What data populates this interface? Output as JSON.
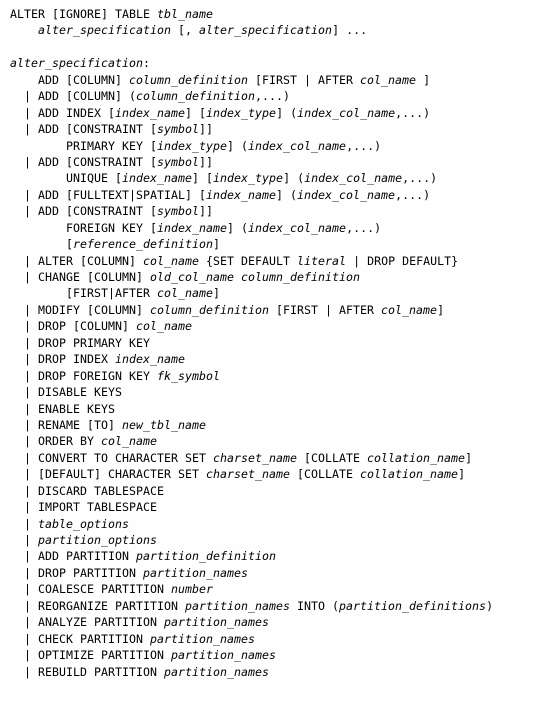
{
  "document": {
    "kind": "sql-syntax-reference",
    "statement": "ALTER TABLE",
    "background_color": "#fefefe",
    "text_color": "#000000",
    "font_size_px": 11.6,
    "line_height_px": 16.45,
    "right_edge_clipped": true
  },
  "lines": [
    {
      "indent": 0,
      "spans": [
        {
          "t": "ALTER [IGNORE] TABLE ",
          "s": "kw"
        },
        {
          "t": "tbl_name",
          "s": "ph"
        }
      ]
    },
    {
      "indent": 0,
      "spans": [
        {
          "t": "    ",
          "s": "kw"
        },
        {
          "t": "alter_specification",
          "s": "ph"
        },
        {
          "t": " [, ",
          "s": "kw"
        },
        {
          "t": "alter_specification",
          "s": "ph"
        },
        {
          "t": "] ...",
          "s": "kw"
        }
      ]
    },
    {
      "indent": 0,
      "spans": []
    },
    {
      "indent": 0,
      "spans": [
        {
          "t": "alter_specification",
          "s": "ph"
        },
        {
          "t": ":",
          "s": "kw"
        }
      ]
    },
    {
      "indent": 0,
      "spans": [
        {
          "t": "    ADD [COLUMN] ",
          "s": "kw"
        },
        {
          "t": "column_definition",
          "s": "ph"
        },
        {
          "t": " [FIRST | AFTER ",
          "s": "kw"
        },
        {
          "t": "col_name",
          "s": "ph"
        },
        {
          "t": " ]",
          "s": "kw"
        }
      ]
    },
    {
      "indent": 0,
      "spans": [
        {
          "t": "  | ADD [COLUMN] (",
          "s": "kw"
        },
        {
          "t": "column_definition",
          "s": "ph"
        },
        {
          "t": ",...)",
          "s": "kw"
        }
      ]
    },
    {
      "indent": 0,
      "spans": [
        {
          "t": "  | ADD INDEX [",
          "s": "kw"
        },
        {
          "t": "index_name",
          "s": "ph"
        },
        {
          "t": "] [",
          "s": "kw"
        },
        {
          "t": "index_type",
          "s": "ph"
        },
        {
          "t": "] (",
          "s": "kw"
        },
        {
          "t": "index_col_name",
          "s": "ph"
        },
        {
          "t": ",...)",
          "s": "kw"
        }
      ]
    },
    {
      "indent": 0,
      "spans": [
        {
          "t": "  | ADD [CONSTRAINT [",
          "s": "kw"
        },
        {
          "t": "symbol",
          "s": "ph"
        },
        {
          "t": "]]",
          "s": "kw"
        }
      ]
    },
    {
      "indent": 0,
      "spans": [
        {
          "t": "        PRIMARY KEY [",
          "s": "kw"
        },
        {
          "t": "index_type",
          "s": "ph"
        },
        {
          "t": "] (",
          "s": "kw"
        },
        {
          "t": "index_col_name",
          "s": "ph"
        },
        {
          "t": ",...)",
          "s": "kw"
        }
      ]
    },
    {
      "indent": 0,
      "spans": [
        {
          "t": "  | ADD [CONSTRAINT [",
          "s": "kw"
        },
        {
          "t": "symbol",
          "s": "ph"
        },
        {
          "t": "]]",
          "s": "kw"
        }
      ]
    },
    {
      "indent": 0,
      "spans": [
        {
          "t": "        UNIQUE [",
          "s": "kw"
        },
        {
          "t": "index_name",
          "s": "ph"
        },
        {
          "t": "] [",
          "s": "kw"
        },
        {
          "t": "index_type",
          "s": "ph"
        },
        {
          "t": "] (",
          "s": "kw"
        },
        {
          "t": "index_col_name",
          "s": "ph"
        },
        {
          "t": ",...)",
          "s": "kw"
        }
      ]
    },
    {
      "indent": 0,
      "spans": [
        {
          "t": "  | ADD [FULLTEXT|SPATIAL] [",
          "s": "kw"
        },
        {
          "t": "index_name",
          "s": "ph"
        },
        {
          "t": "] (",
          "s": "kw"
        },
        {
          "t": "index_col_name",
          "s": "ph"
        },
        {
          "t": ",...)",
          "s": "kw"
        }
      ]
    },
    {
      "indent": 0,
      "spans": [
        {
          "t": "  | ADD [CONSTRAINT [",
          "s": "kw"
        },
        {
          "t": "symbol",
          "s": "ph"
        },
        {
          "t": "]]",
          "s": "kw"
        }
      ]
    },
    {
      "indent": 0,
      "spans": [
        {
          "t": "        FOREIGN KEY [",
          "s": "kw"
        },
        {
          "t": "index_name",
          "s": "ph"
        },
        {
          "t": "] (",
          "s": "kw"
        },
        {
          "t": "index_col_name",
          "s": "ph"
        },
        {
          "t": ",...)",
          "s": "kw"
        }
      ]
    },
    {
      "indent": 0,
      "spans": [
        {
          "t": "        [",
          "s": "kw"
        },
        {
          "t": "reference_definition",
          "s": "ph"
        },
        {
          "t": "]",
          "s": "kw"
        }
      ]
    },
    {
      "indent": 0,
      "spans": [
        {
          "t": "  | ALTER [COLUMN] ",
          "s": "kw"
        },
        {
          "t": "col_name",
          "s": "ph"
        },
        {
          "t": " {SET DEFAULT ",
          "s": "kw"
        },
        {
          "t": "literal",
          "s": "ph"
        },
        {
          "t": " | DROP DEFAULT}",
          "s": "kw"
        }
      ]
    },
    {
      "indent": 0,
      "spans": [
        {
          "t": "  | CHANGE [COLUMN] ",
          "s": "kw"
        },
        {
          "t": "old_col_name column_definition",
          "s": "ph"
        }
      ]
    },
    {
      "indent": 0,
      "spans": [
        {
          "t": "        [FIRST|AFTER ",
          "s": "kw"
        },
        {
          "t": "col_name",
          "s": "ph"
        },
        {
          "t": "]",
          "s": "kw"
        }
      ]
    },
    {
      "indent": 0,
      "spans": [
        {
          "t": "  | MODIFY [COLUMN] ",
          "s": "kw"
        },
        {
          "t": "column_definition",
          "s": "ph"
        },
        {
          "t": " [FIRST | AFTER ",
          "s": "kw"
        },
        {
          "t": "col_name",
          "s": "ph"
        },
        {
          "t": "]",
          "s": "kw"
        }
      ]
    },
    {
      "indent": 0,
      "spans": [
        {
          "t": "  | DROP [COLUMN] ",
          "s": "kw"
        },
        {
          "t": "col_name",
          "s": "ph"
        }
      ]
    },
    {
      "indent": 0,
      "spans": [
        {
          "t": "  | DROP PRIMARY KEY",
          "s": "kw"
        }
      ]
    },
    {
      "indent": 0,
      "spans": [
        {
          "t": "  | DROP INDEX ",
          "s": "kw"
        },
        {
          "t": "index_name",
          "s": "ph"
        }
      ]
    },
    {
      "indent": 0,
      "spans": [
        {
          "t": "  | DROP FOREIGN KEY ",
          "s": "kw"
        },
        {
          "t": "fk_symbol",
          "s": "ph"
        }
      ]
    },
    {
      "indent": 0,
      "spans": [
        {
          "t": "  | DISABLE KEYS",
          "s": "kw"
        }
      ]
    },
    {
      "indent": 0,
      "spans": [
        {
          "t": "  | ENABLE KEYS",
          "s": "kw"
        }
      ]
    },
    {
      "indent": 0,
      "spans": [
        {
          "t": "  | RENAME [TO] ",
          "s": "kw"
        },
        {
          "t": "new_tbl_name",
          "s": "ph"
        }
      ]
    },
    {
      "indent": 0,
      "spans": [
        {
          "t": "  | ORDER BY ",
          "s": "kw"
        },
        {
          "t": "col_name",
          "s": "ph"
        }
      ]
    },
    {
      "indent": 0,
      "spans": [
        {
          "t": "  | CONVERT TO CHARACTER SET ",
          "s": "kw"
        },
        {
          "t": "charset_name",
          "s": "ph"
        },
        {
          "t": " [COLLATE ",
          "s": "kw"
        },
        {
          "t": "collation_name",
          "s": "ph"
        },
        {
          "t": "]",
          "s": "kw"
        }
      ]
    },
    {
      "indent": 0,
      "spans": [
        {
          "t": "  | [DEFAULT] CHARACTER SET ",
          "s": "kw"
        },
        {
          "t": "charset_name",
          "s": "ph"
        },
        {
          "t": " [COLLATE ",
          "s": "kw"
        },
        {
          "t": "collation_name",
          "s": "ph"
        },
        {
          "t": "]",
          "s": "kw"
        }
      ]
    },
    {
      "indent": 0,
      "spans": [
        {
          "t": "  | DISCARD TABLESPACE",
          "s": "kw"
        }
      ]
    },
    {
      "indent": 0,
      "spans": [
        {
          "t": "  | IMPORT TABLESPACE",
          "s": "kw"
        }
      ]
    },
    {
      "indent": 0,
      "spans": [
        {
          "t": "  | ",
          "s": "kw"
        },
        {
          "t": "table_options",
          "s": "ph"
        }
      ]
    },
    {
      "indent": 0,
      "spans": [
        {
          "t": "  | ",
          "s": "kw"
        },
        {
          "t": "partition_options",
          "s": "ph"
        }
      ]
    },
    {
      "indent": 0,
      "spans": [
        {
          "t": "  | ADD PARTITION ",
          "s": "kw"
        },
        {
          "t": "partition_definition",
          "s": "ph"
        }
      ]
    },
    {
      "indent": 0,
      "spans": [
        {
          "t": "  | DROP PARTITION ",
          "s": "kw"
        },
        {
          "t": "partition_names",
          "s": "ph"
        }
      ]
    },
    {
      "indent": 0,
      "spans": [
        {
          "t": "  | COALESCE PARTITION ",
          "s": "kw"
        },
        {
          "t": "number",
          "s": "ph"
        }
      ]
    },
    {
      "indent": 0,
      "spans": [
        {
          "t": "  | REORGANIZE PARTITION ",
          "s": "kw"
        },
        {
          "t": "partition_names",
          "s": "ph"
        },
        {
          "t": " INTO (",
          "s": "kw"
        },
        {
          "t": "partition_definitions",
          "s": "ph"
        },
        {
          "t": ")",
          "s": "kw"
        }
      ]
    },
    {
      "indent": 0,
      "spans": [
        {
          "t": "  | ANALYZE PARTITION ",
          "s": "kw"
        },
        {
          "t": "partition_names",
          "s": "ph"
        }
      ]
    },
    {
      "indent": 0,
      "spans": [
        {
          "t": "  | CHECK PARTITION ",
          "s": "kw"
        },
        {
          "t": "partition_names",
          "s": "ph"
        }
      ]
    },
    {
      "indent": 0,
      "spans": [
        {
          "t": "  | OPTIMIZE PARTITION ",
          "s": "kw"
        },
        {
          "t": "partition_names",
          "s": "ph"
        }
      ]
    },
    {
      "indent": 0,
      "spans": [
        {
          "t": "  | REBUILD PARTITION ",
          "s": "kw"
        },
        {
          "t": "partition_names",
          "s": "ph"
        }
      ]
    }
  ]
}
